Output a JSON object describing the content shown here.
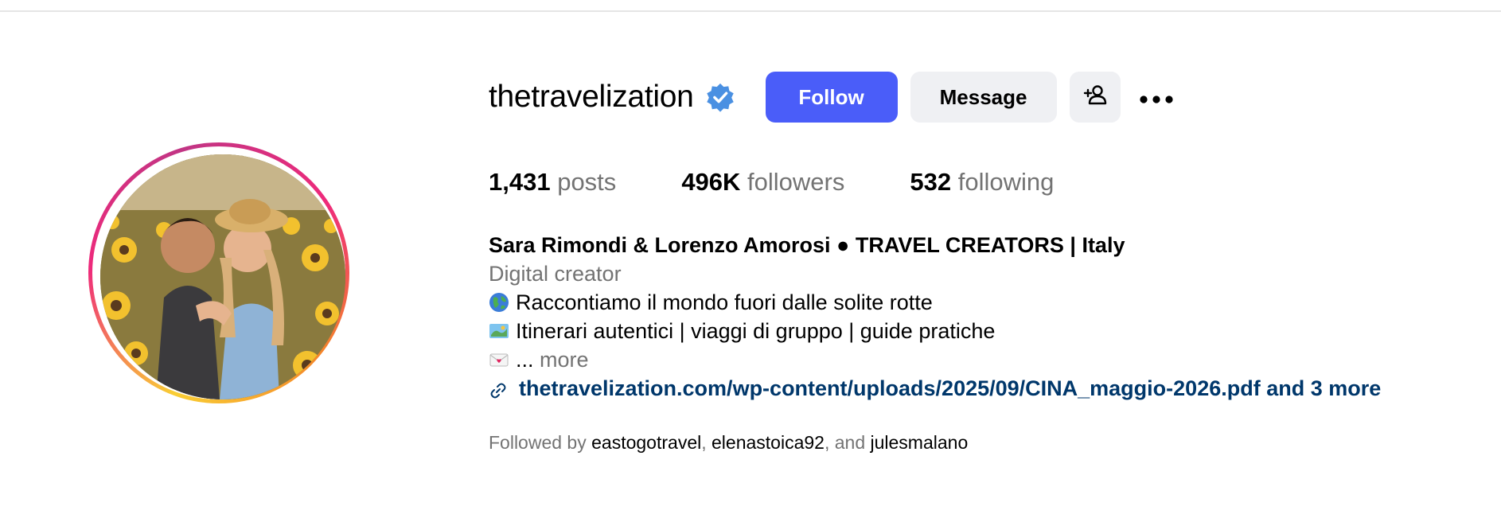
{
  "profile": {
    "username": "thetravelization",
    "verified_icon": "verified-badge-icon",
    "follow_label": "Follow",
    "message_label": "Message",
    "add_user_icon": "add-user-icon",
    "more_icon": "more-options-icon"
  },
  "stats": {
    "posts": {
      "count": "1,431",
      "label": "posts"
    },
    "followers": {
      "count": "496K",
      "label": "followers"
    },
    "following": {
      "count": "532",
      "label": "following"
    }
  },
  "bio": {
    "full_name": "Sara Rimondi & Lorenzo Amorosi ● TRAVEL CREATORS | Italy",
    "category": "Digital creator",
    "line1": "Raccontiamo il mondo fuori dalle solite rotte",
    "line1_icon": "globe-icon",
    "line2": "Itinerari autentici | viaggi di gruppo | guide pratiche",
    "line2_icon": "map-icon",
    "line3_icon": "love-letter-icon",
    "line3_ellipsis": "...",
    "more_label": "more",
    "link_icon": "link-icon",
    "link_text": "thetravelization.com/wp-content/uploads/2025/09/CINA_maggio-2026.pdf and 3 more"
  },
  "followed_by": {
    "prefix": "Followed by",
    "account1": "eastogotravel",
    "sep1": ",",
    "account2": "elenastoica92",
    "sep2": ", and",
    "account3": "julesmalano"
  },
  "colors": {
    "follow_button": "#4a5df9",
    "secondary_button": "#eff0f3",
    "link": "#00376b",
    "muted_text": "#737373",
    "verified": "#4a90e2"
  }
}
